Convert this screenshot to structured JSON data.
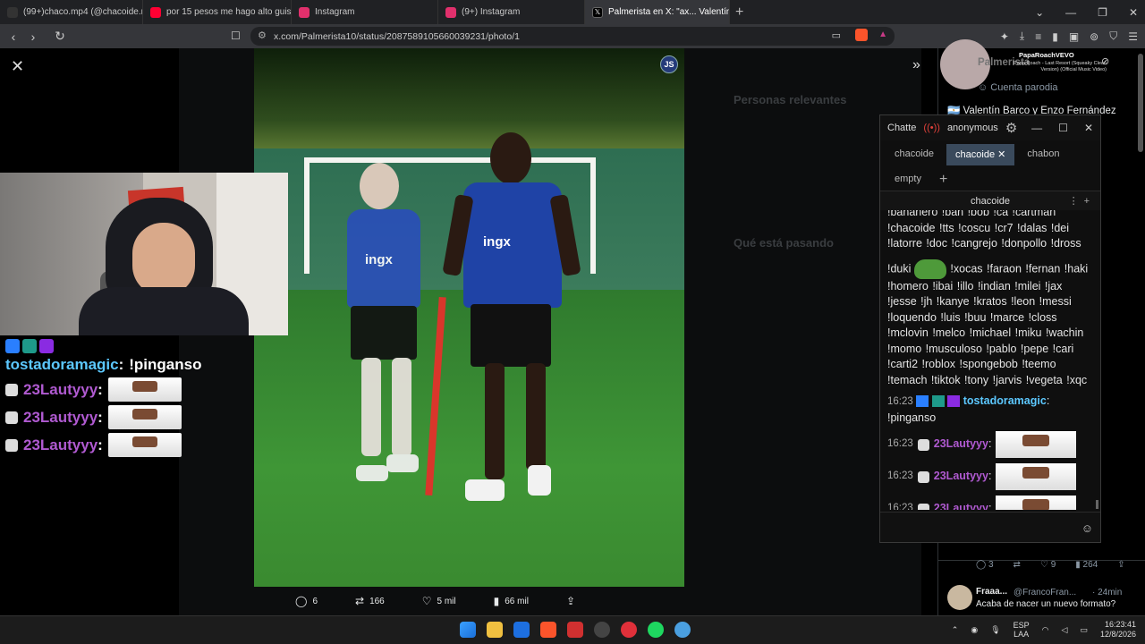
{
  "browser": {
    "tabs": [
      {
        "label": "(99+)chaco.mp4 (@chacoide.mp4) | TikTok",
        "favicon_color": "#111111",
        "active": false
      },
      {
        "label": "por 15 pesos me hago alto guiso \"Vi...",
        "favicon_color": "#ff0033",
        "active": false
      },
      {
        "label": "Instagram",
        "favicon_color": "#e1306c",
        "active": false
      },
      {
        "label": "(9+) Instagram",
        "favicon_color": "#e1306c",
        "active": false
      },
      {
        "label": "Palmerista en X: \"ax... Valentín B...",
        "favicon_color": "#000000",
        "active": true
      }
    ],
    "new_tab": "+",
    "url": "x.com/Palmerista10/status/2087589105660039231/photo/1"
  },
  "photo": {
    "badge": "JS",
    "sponsor": "ingx",
    "sponsor_left": "ingx"
  },
  "tweet_actions": {
    "replies": "6",
    "reposts": "166",
    "likes": "5 mil",
    "views": "66 mil"
  },
  "side": {
    "now_playing_artist": "PapaRoachVEVO",
    "now_playing_title": "Papa Roach - Last Resort (Squeaky Clean Version) (Official Music Video)",
    "author_name": "Palmerista",
    "author_label": "Cuenta parodia",
    "tweet_text": "Valentín Barco y Enzo Fernández",
    "reply_stats": {
      "replies": "3",
      "likes": "9",
      "views": "264"
    },
    "reply_name": "Fraaa...",
    "reply_handle": "@FrancoFran...",
    "reply_time": "· 24min",
    "reply_text": "Acaba de nacer un nuevo formato?"
  },
  "overlay_chat": {
    "line1_user": "tostadoramagic",
    "line1_msg": "!pinganso",
    "repeat_user": "23Lautyyy"
  },
  "chatterino": {
    "title": "Chatte",
    "account": "anonymous",
    "splits": [
      "chacoide",
      "chacoide",
      "chabon",
      "empty"
    ],
    "channel": "chacoide",
    "commands_a": "!bananero !ban !bob !ca !cartman !chacoide !tts !coscu !cr7 !dalas !dei !latorre !doc !cangrejo !donpollo !dross",
    "commands_b_pre": "!duki",
    "commands_b": "!xocas !faraon !fernan !haki !homero !ibai !illo !indian !milei !jax !jesse !jh !kanye !kratos !leon !messi !loquendo !luis !buu !marce !closs !mclovin !melco !michael !miku !wachin !momo !musculoso !pablo !pepe !cari !carti2 !roblox !spongebob !teemo !temach !tiktok !tony !jarvis !vegeta !xqc",
    "msg_time": "16:23",
    "msg_user": "tostadoramagic",
    "msg_text": "!pinganso",
    "rep_user": "23Lautyyy",
    "rep_time": "16:23"
  },
  "taskbar": {
    "lang": "ESP",
    "region": "LAA",
    "time": "16:23:41",
    "date": "12/8/2026"
  }
}
